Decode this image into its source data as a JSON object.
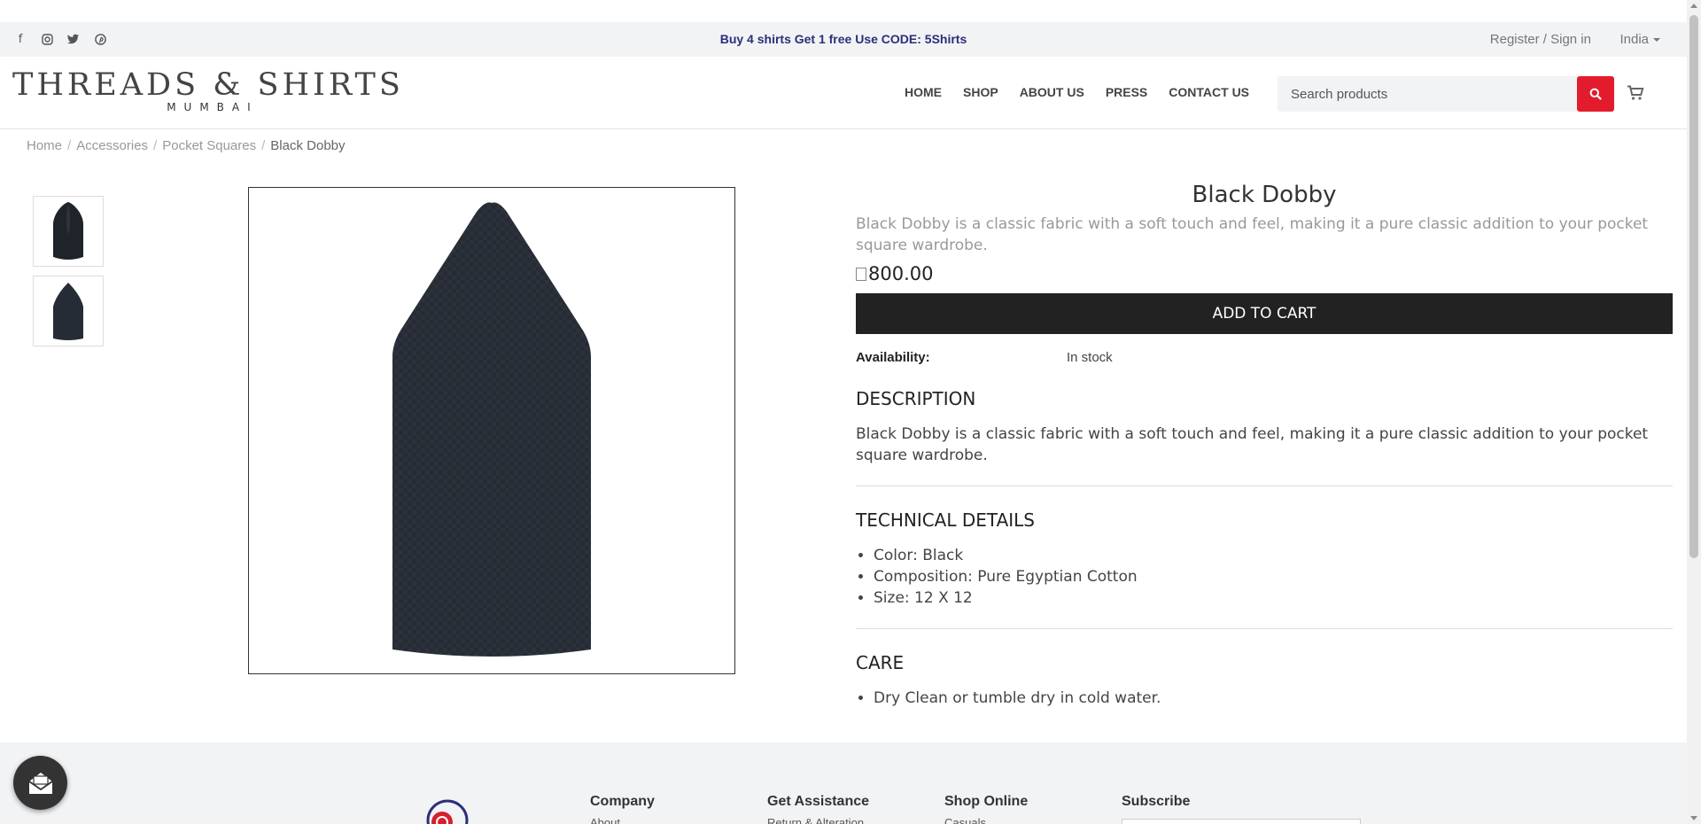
{
  "topbar": {
    "social_icons": [
      "facebook-icon",
      "instagram-icon",
      "twitter-icon",
      "pinterest-icon"
    ],
    "promo": "Buy 4 shirts Get 1 free Use CODE: 5Shirts",
    "auth_link": "Register / Sign in",
    "country": "India"
  },
  "header": {
    "logo_main": "THREADS & SHIRTS",
    "logo_sub": "MUMBAI",
    "nav": [
      "HOME",
      "SHOP",
      "ABOUT US",
      "PRESS",
      "CONTACT US"
    ],
    "search_placeholder": "Search products",
    "search_icon": "search-icon",
    "cart_icon": "cart-icon"
  },
  "breadcrumb": {
    "items": [
      "Home",
      "Accessories",
      "Pocket Squares"
    ],
    "current": "Black Dobby"
  },
  "product": {
    "title": "Black Dobby",
    "short_description": "Black Dobby is a classic fabric with a soft touch and feel, making it a pure classic addition to your pocket square wardrobe.",
    "price": "800.00",
    "add_to_cart": "ADD TO CART",
    "availability_label": "Availability:",
    "availability_value": "In stock",
    "sections": {
      "description": {
        "heading": "DESCRIPTION",
        "text": "Black Dobby is a classic fabric with a soft touch and feel, making it a pure classic addition to your pocket square wardrobe."
      },
      "technical": {
        "heading": "TECHNICAL DETAILS",
        "items": [
          "Color: Black",
          "Composition: Pure Egyptian Cotton",
          "Size: 12 X 12"
        ]
      },
      "care": {
        "heading": "CARE",
        "items": [
          "Dry Clean or tumble dry in cold water."
        ]
      }
    }
  },
  "footer": {
    "columns": [
      "Company",
      "Get Assistance",
      "Shop Online",
      "Subscribe"
    ],
    "sub_items": [
      "About",
      "Return & Alteration",
      "Casuals"
    ]
  },
  "colors": {
    "accent_red": "#e31c2d",
    "promo_text": "#2b2f7a",
    "button_dark": "#222222"
  }
}
